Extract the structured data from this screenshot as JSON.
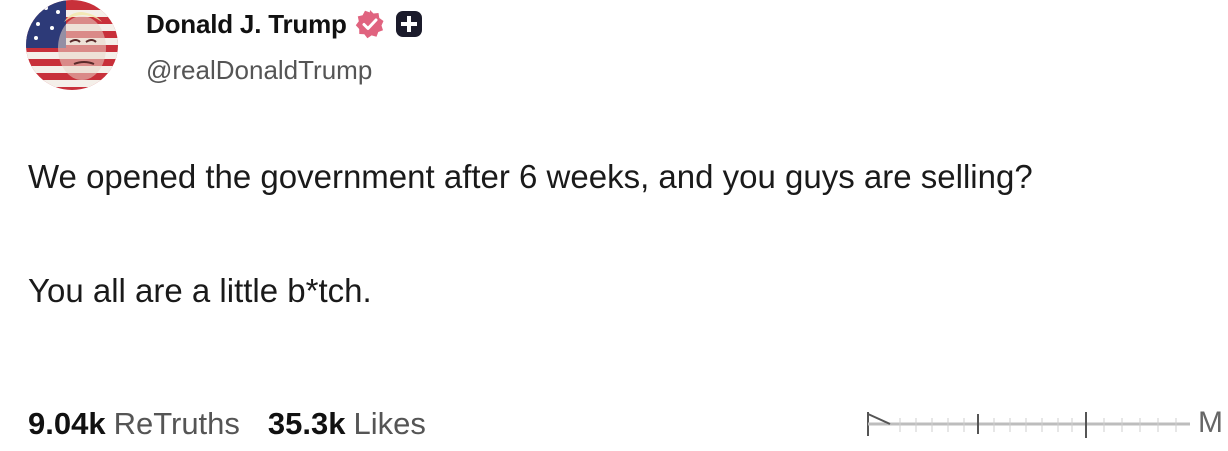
{
  "author": {
    "display_name": "Donald J. Trump",
    "handle": "@realDonaldTrump",
    "avatar_icon": "flag-portrait-avatar",
    "verified_icon": "verified-badge-icon",
    "verified_color": "#e0637f",
    "plus_icon": "plus-badge-icon"
  },
  "post": {
    "paragraphs": [
      "We opened the government after 6 weeks, and you guys are selling?",
      "You all are a little b*tch."
    ]
  },
  "stats": {
    "retruths_count": "9.04k",
    "retruths_label": "ReTruths",
    "likes_count": "35.3k",
    "likes_label": "Likes"
  },
  "timeline": {
    "trailing_letter": "M"
  },
  "colors": {
    "text_primary": "#111111",
    "text_secondary": "#555555",
    "background": "#ffffff"
  }
}
